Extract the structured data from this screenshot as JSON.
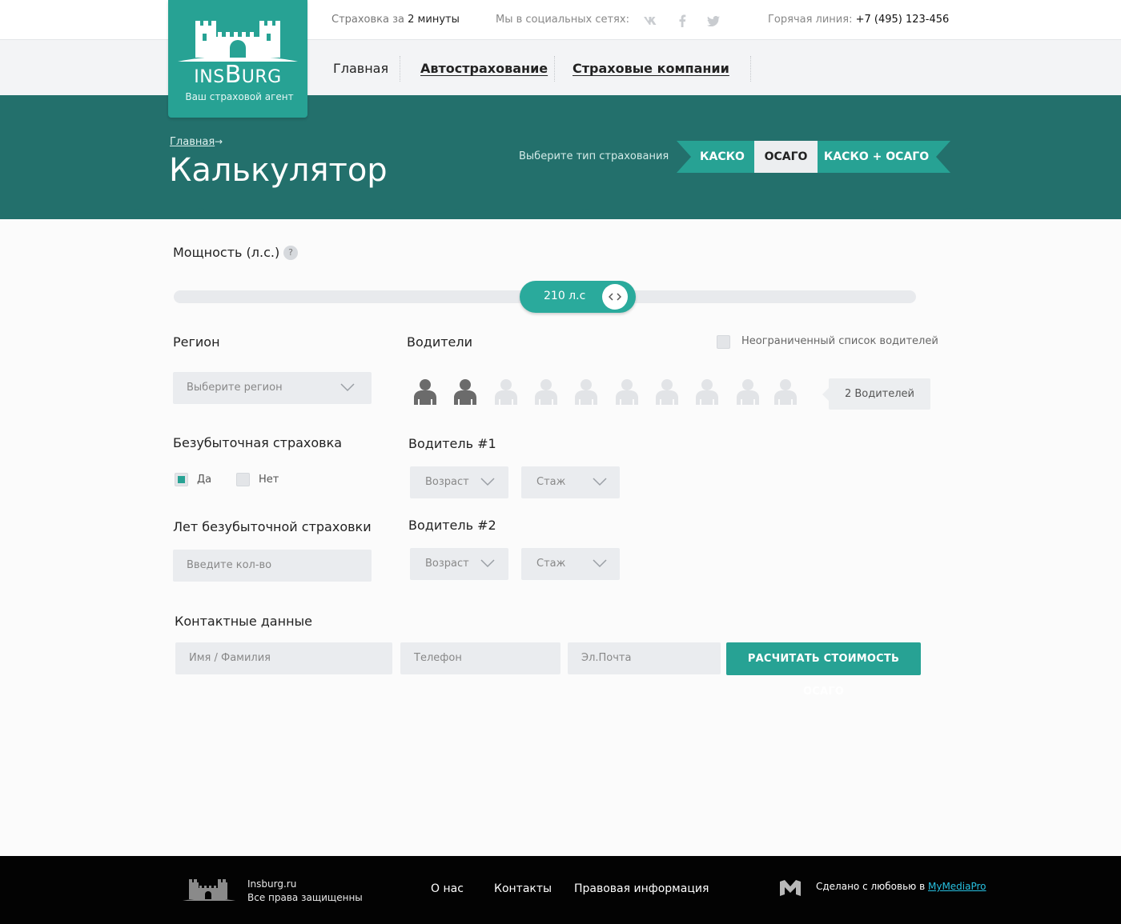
{
  "topbar": {
    "promo_prefix": "Страховка за",
    "promo_highlight": "2 минуты",
    "social_label": "Мы в социальных сетях:",
    "social_icons": [
      "vk-icon",
      "facebook-icon",
      "twitter-icon"
    ],
    "hotline_label": "Горячая линия:",
    "hotline_phone": "+7 (495) 123-456"
  },
  "logo": {
    "brand_ins": "INS",
    "brand_b": "B",
    "brand_urg": "URG",
    "tagline": "Ваш страховой агент"
  },
  "nav": {
    "items": [
      {
        "label": "Главная"
      },
      {
        "label": "Автострахование"
      },
      {
        "label": "Страховые компании"
      }
    ]
  },
  "hero": {
    "breadcrumb": "Главная",
    "title": "Калькулятор",
    "type_label": "Выберите тип страхования",
    "types": [
      "КАСКО",
      "ОСАГО",
      "КАСКО + ОСАГО"
    ],
    "active_type": "ОСАГО"
  },
  "form": {
    "power": {
      "label": "Мощность (л.с.)",
      "help": "?",
      "value_label": "210 л.с",
      "value": 210
    },
    "region": {
      "label": "Регион",
      "placeholder": "Выберите регион"
    },
    "drivers": {
      "label": "Водители",
      "unlimited_label": "Неограниченный список водителей",
      "unlimited_checked": false,
      "selected": 2,
      "total_icons": 10,
      "count_label": "2 Водителей"
    },
    "no_claims": {
      "label": "Безубыточная страховка",
      "yes": "Да",
      "no": "Нет",
      "selected": "Да"
    },
    "no_claims_years": {
      "label": "Лет безубыточной страховки",
      "placeholder": "Введите кол-во"
    },
    "driver1": {
      "label": "Водитель #1",
      "age": "Возраст",
      "experience": "Стаж"
    },
    "driver2": {
      "label": "Водитель #2",
      "age": "Возраст",
      "experience": "Стаж"
    },
    "contacts": {
      "label": "Контактные данные",
      "name_placeholder": "Имя / Фамилия",
      "phone_placeholder": "Телефон",
      "email_placeholder": "Эл.Почта",
      "submit": "РАСЧИТАТЬ СТОИМОСТЬ ОСАГО"
    }
  },
  "footer": {
    "site": "Insburg.ru",
    "rights": "Все права защищенны",
    "links": [
      "О нас",
      "Контакты",
      "Правовая информация"
    ],
    "made_prefix": "Сделано с любовью в",
    "made_link": "MyMediaPro"
  },
  "colors": {
    "accent": "#27a294",
    "hero": "#23706c",
    "footer": "#030303",
    "driver_active": "#6b6b6b",
    "driver_inactive": "#e2e4e7"
  }
}
